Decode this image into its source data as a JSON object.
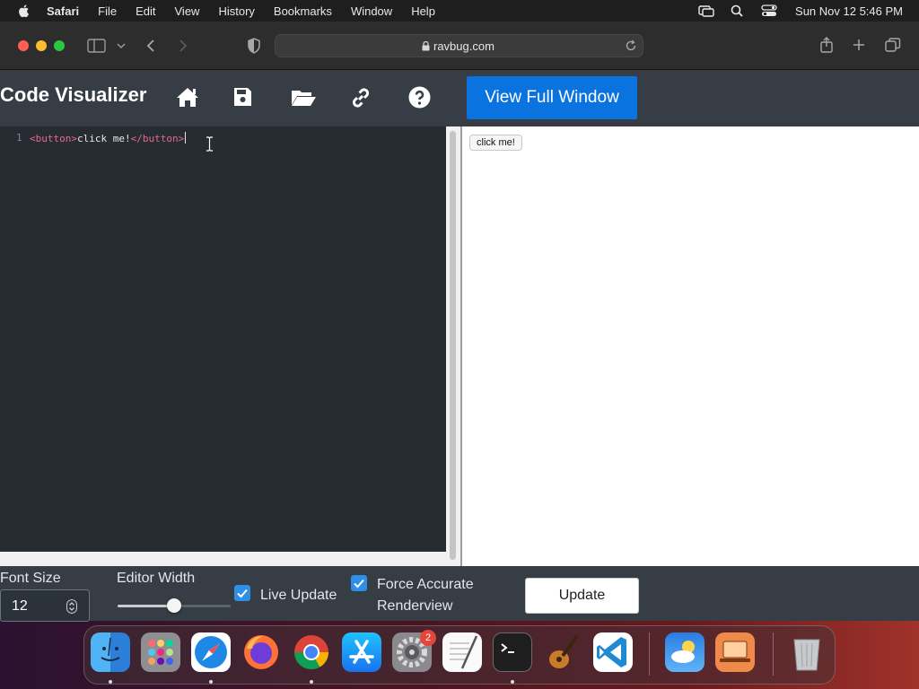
{
  "menubar": {
    "app": "Safari",
    "items": [
      "File",
      "Edit",
      "View",
      "History",
      "Bookmarks",
      "Window",
      "Help"
    ],
    "clock": "Sun Nov 12  5:46 PM"
  },
  "browser": {
    "url": "ravbug.com"
  },
  "app": {
    "title": "Code Visualizer",
    "full_window_label": "View Full Window",
    "nav_icons": [
      "home-icon",
      "save-icon",
      "open-folder-icon",
      "link-icon",
      "help-icon"
    ]
  },
  "editor": {
    "line_number": "1",
    "code_open_tag": "<button>",
    "code_text": "click me!",
    "code_close_tag": "</button>"
  },
  "preview": {
    "button_label": "click me!"
  },
  "controls": {
    "font_size_label": "Font Size",
    "font_size_value": "12",
    "editor_width_label": "Editor Width",
    "editor_width_fraction": 0.5,
    "live_update_label": "Live Update",
    "live_update_checked": true,
    "force_accurate_line1": "Force Accurate",
    "force_accurate_line2": "Renderview",
    "force_accurate_checked": true,
    "update_label": "Update"
  },
  "dock": {
    "apps": [
      "Finder",
      "Launchpad",
      "Safari",
      "Firefox",
      "Chrome",
      "App Store",
      "System Settings",
      "TextEdit",
      "Terminal",
      "GarageBand",
      "Visual Studio Code",
      "Weather",
      "Screen Sharing",
      "Trash"
    ],
    "system_settings_badge": "2"
  },
  "colors": {
    "accent": "#0b73e0",
    "page_bg": "#363d45",
    "editor_bg": "#272c33",
    "tag_color": "#e26c8a",
    "checkbox": "#2f8ee6"
  }
}
